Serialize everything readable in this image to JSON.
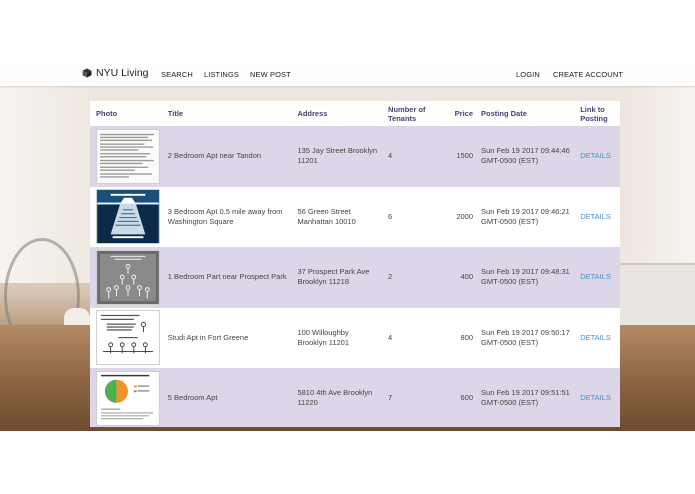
{
  "navbar": {
    "brand": "NYU Living",
    "links": [
      "SEARCH",
      "LISTINGS",
      "NEW POST"
    ],
    "right_links": [
      "LOGIN",
      "CREATE ACCOUNT"
    ]
  },
  "table": {
    "headers": {
      "photo": "Photo",
      "title": "Title",
      "address": "Address",
      "tenants_line1": "Number of",
      "tenants_line2": "Tenants",
      "price": "Price",
      "date": "Posting Date",
      "link_line1": "Link to",
      "link_line2": "Posting"
    },
    "rows": [
      {
        "title_line1": "2 Bedroom Apt near Tandon",
        "title_line2": "",
        "address_line1": "135 Jay Street Brooklyn",
        "address_line2": "11201",
        "tenants": "4",
        "price": "1500",
        "date_line1": "Sun Feb 19 2017 09:44:46",
        "date_line2": "GMT-0500 (EST)",
        "link": "DETAILS"
      },
      {
        "title_line1": "3 Bedroom Apt 0.5 mile away from",
        "title_line2": "Washington Square",
        "address_line1": "56 Green Street",
        "address_line2": "Manhattan 10010",
        "tenants": "6",
        "price": "2000",
        "date_line1": "Sun Feb 19 2017 09:46:21",
        "date_line2": "GMT-0500 (EST)",
        "link": "DETAILS"
      },
      {
        "title_line1": "1 Bedroom Part near Prospect Park",
        "title_line2": "",
        "address_line1": "37 Prospect Park Ave",
        "address_line2": "Brooklyn 11218",
        "tenants": "2",
        "price": "400",
        "date_line1": "Sun Feb 19 2017 09:48:31",
        "date_line2": "GMT-0500 (EST)",
        "link": "DETAILS"
      },
      {
        "title_line1": "Studi Apt in Fort Greene",
        "title_line2": "",
        "address_line1": "100 Willoughby",
        "address_line2": "Brooklyn 11201",
        "tenants": "4",
        "price": "800",
        "date_line1": "Sun Feb 19 2017 09:50:17",
        "date_line2": "GMT-0500 (EST)",
        "link": "DETAILS"
      },
      {
        "title_line1": "5 Bedroom Apt",
        "title_line2": "",
        "address_line1": "5810 4th Ave Brooklyn",
        "address_line2": "11220",
        "tenants": "7",
        "price": "600",
        "date_line1": "Sun Feb 19 2017 09:51:51",
        "date_line2": "GMT-0500 (EST)",
        "link": "DETAILS"
      }
    ]
  },
  "colors": {
    "header_text": "#4a4170",
    "row_shade": "#ddd6e8",
    "link": "#4a90c8"
  },
  "icons": {
    "brand": "cube-icon"
  }
}
